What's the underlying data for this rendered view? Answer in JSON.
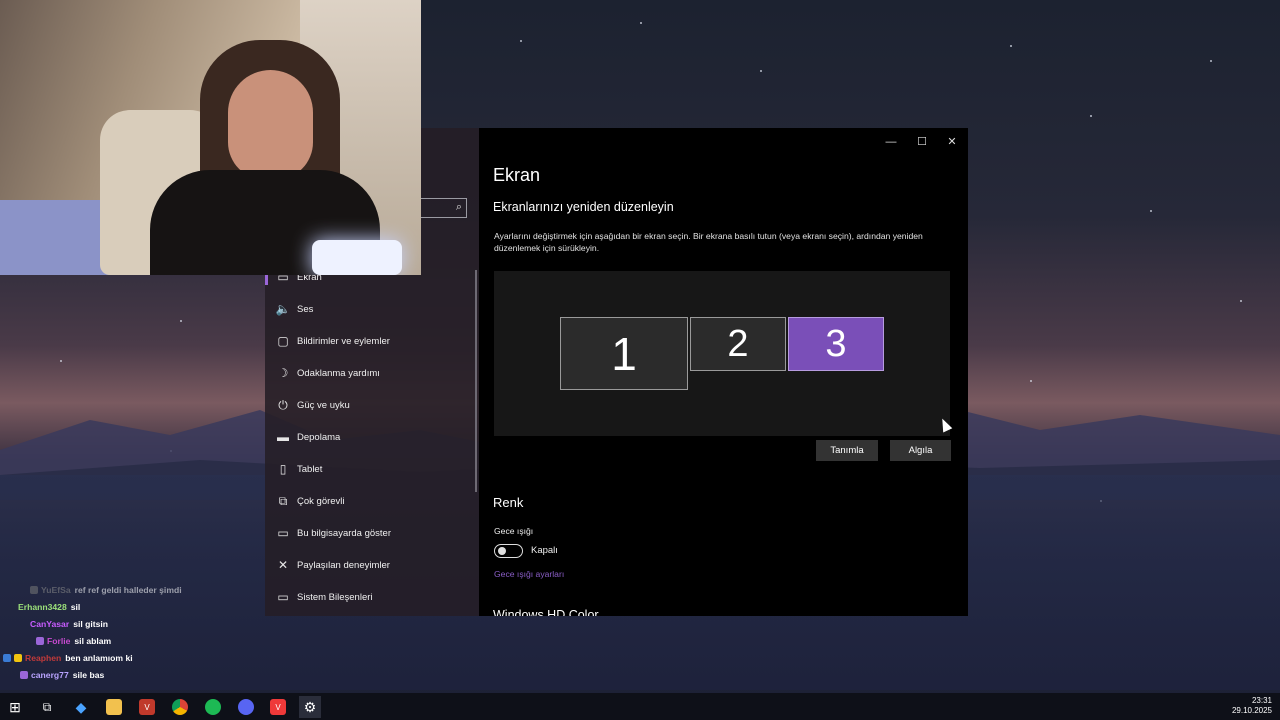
{
  "window": {
    "minimize_icon": "—",
    "maximize_icon": "☐",
    "close_icon": "✕",
    "search_icon": "⌕"
  },
  "sidebar": {
    "items": [
      {
        "label": "Ekran",
        "icon": "display-icon",
        "glyph": "▭"
      },
      {
        "label": "Ses",
        "icon": "speaker-icon",
        "glyph": "🔈"
      },
      {
        "label": "Bildirimler ve eylemler",
        "icon": "notification-icon",
        "glyph": "▢"
      },
      {
        "label": "Odaklanma yardımı",
        "icon": "moon-icon",
        "glyph": "☽"
      },
      {
        "label": "Güç ve uyku",
        "icon": "power-icon",
        "glyph": "⏻"
      },
      {
        "label": "Depolama",
        "icon": "storage-icon",
        "glyph": "▬"
      },
      {
        "label": "Tablet",
        "icon": "tablet-icon",
        "glyph": "▯"
      },
      {
        "label": "Çok görevli",
        "icon": "multitask-icon",
        "glyph": "⧉"
      },
      {
        "label": "Bu bilgisayarda göster",
        "icon": "project-icon",
        "glyph": "▭"
      },
      {
        "label": "Paylaşılan deneyimler",
        "icon": "shared-icon",
        "glyph": "✕"
      },
      {
        "label": "Sistem Bileşenleri",
        "icon": "components-icon",
        "glyph": "▭"
      }
    ]
  },
  "main": {
    "title": "Ekran",
    "section_title": "Ekranlarınızı yeniden düzenleyin",
    "description": "Ayarlarını değiştirmek için aşağıdan bir ekran seçin. Bir ekrana basılı tutun (veya ekranı seçin), ardından yeniden düzenlemek için sürükleyin.",
    "monitors": [
      "1",
      "2",
      "3"
    ],
    "identify_label": "Tanımla",
    "detect_label": "Algıla",
    "color_title": "Renk",
    "night_light_label": "Gece ışığı",
    "night_light_state": "Kapalı",
    "night_light_link": "Gece ışığı ayarları",
    "next_section_partial": "Windows HD Color"
  },
  "chat": [
    {
      "user": "YuEfSa",
      "color": "#8a8a8a",
      "message": "ref ref geldi halleder şimdi",
      "faded": true
    },
    {
      "user": "Erhann3428",
      "color": "#9be07a",
      "message": "sil"
    },
    {
      "user": "CanYasar",
      "color": "#c85cff",
      "message": "sil gitsin"
    },
    {
      "user": "Forlie",
      "color": "#c84ad0",
      "message": "sil ablam"
    },
    {
      "user": "Reaphen",
      "color": "#c23a3a",
      "message": "ben anlamıom ki"
    },
    {
      "user": "canerg77",
      "color": "#b9a4ff",
      "message": "sile bas"
    }
  ],
  "taskbar": {
    "apps": [
      {
        "name": "start-icon",
        "glyph": "⊞",
        "color": "#ffffff"
      },
      {
        "name": "task-view-icon",
        "glyph": "⧉",
        "color": "#cccccc"
      },
      {
        "name": "copilot-icon",
        "glyph": "◆",
        "color": "#4aa3ff"
      },
      {
        "name": "file-explorer-icon",
        "glyph": "▬",
        "color": "#f2c14e"
      },
      {
        "name": "voicemeeter-icon",
        "glyph": "V",
        "color": "#c0392b"
      },
      {
        "name": "chrome-icon",
        "glyph": "●",
        "color": "#e8b400"
      },
      {
        "name": "spotify-icon",
        "glyph": "●",
        "color": "#1db954"
      },
      {
        "name": "discord-icon",
        "glyph": "◎",
        "color": "#5865f2"
      },
      {
        "name": "vivaldi-icon",
        "glyph": "V",
        "color": "#ef3939"
      },
      {
        "name": "settings-icon",
        "glyph": "⚙",
        "color": "#ffffff"
      }
    ],
    "time": "23:31",
    "date": "29.10.2025"
  },
  "colors": {
    "accent": "#7a4fb8",
    "link": "#8a5ec7",
    "window_bg": "#000000"
  }
}
